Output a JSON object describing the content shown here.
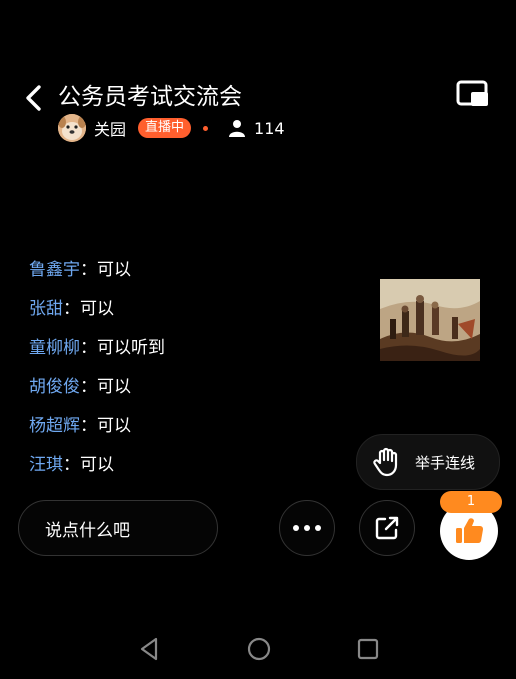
{
  "header": {
    "title": "公务员考试交流会",
    "host_name": "关园",
    "live_badge": "直播中",
    "viewer_count": "114"
  },
  "chat": [
    {
      "user": "鲁鑫宇",
      "message": "可以"
    },
    {
      "user": "张甜",
      "message": "可以"
    },
    {
      "user": "童柳柳",
      "message": "可以听到"
    },
    {
      "user": "胡俊俊",
      "message": "可以"
    },
    {
      "user": "杨超辉",
      "message": "可以"
    },
    {
      "user": "汪琪",
      "message": "可以"
    }
  ],
  "chat_separator": "：",
  "raise_hand": {
    "label": "举手连线"
  },
  "input": {
    "placeholder": "说点什么吧"
  },
  "like": {
    "count": "1"
  },
  "colors": {
    "accent": "#ff5f2e",
    "like": "#ff8a1f",
    "username": "#6fa8f0"
  },
  "icons": {
    "back": "chevron-left-icon",
    "pip": "picture-in-picture-icon",
    "viewers": "person-icon",
    "raise_hand": "hand-icon",
    "more": "more-dots-icon",
    "share": "share-icon",
    "like": "thumbs-up-icon"
  }
}
